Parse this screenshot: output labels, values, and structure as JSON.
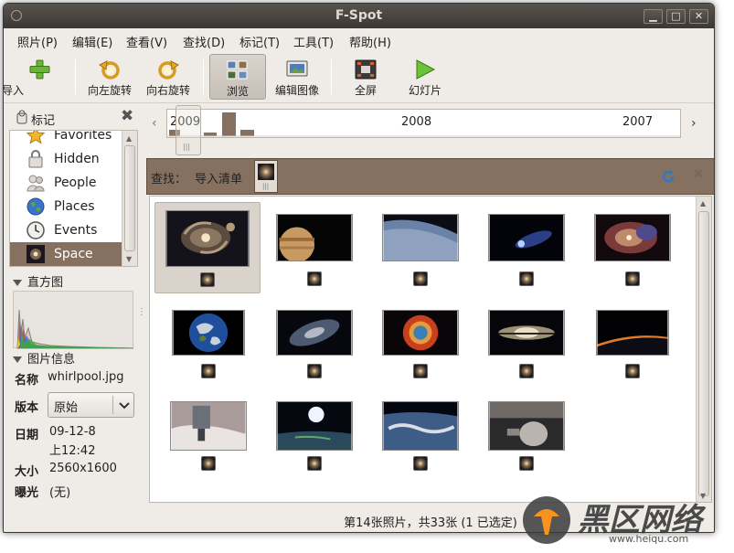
{
  "window": {
    "title": "F-Spot",
    "min_label": "▁",
    "max_label": "□",
    "close_label": "✕"
  },
  "menu": [
    "照片(P)",
    "编辑(E)",
    "查看(V)",
    "查找(D)",
    "标记(T)",
    "工具(T)",
    "帮助(H)"
  ],
  "toolbar": {
    "import": "导入",
    "rotate_left": "向左旋转",
    "rotate_right": "向右旋转",
    "browse": "浏览",
    "edit_image": "编辑图像",
    "fullscreen": "全屏",
    "slideshow": "幻灯片"
  },
  "sidebar": {
    "tags_label": "标记",
    "tags": [
      {
        "label": "Favorites",
        "icon": "star-icon"
      },
      {
        "label": "Hidden",
        "icon": "lock-icon"
      },
      {
        "label": "People",
        "icon": "people-icon"
      },
      {
        "label": "Places",
        "icon": "globe-icon"
      },
      {
        "label": "Events",
        "icon": "clock-icon"
      },
      {
        "label": "Space",
        "icon": "galaxy-icon",
        "selected": true
      }
    ],
    "histogram_label": "直方图",
    "info_label": "图片信息",
    "info": {
      "name_key": "名称",
      "name_val": "whirlpool.jpg",
      "version_key": "版本",
      "version_val": "原始",
      "date_key": "日期",
      "date_val": "09-12-8",
      "time_val": "上12:42",
      "size_key": "大小",
      "size_val": "2560x1600",
      "exposure_key": "曝光",
      "exposure_val": "(无)"
    }
  },
  "timeline": {
    "years": [
      "2009",
      "2008",
      "2007"
    ]
  },
  "findbar": {
    "label": "查找：",
    "query": "导入清单"
  },
  "photos": [
    {
      "name": "whirlpool galaxy",
      "selected": true
    },
    {
      "name": "jupiter"
    },
    {
      "name": "earth horizon"
    },
    {
      "name": "comet"
    },
    {
      "name": "orion nebula"
    },
    {
      "name": "blue marble"
    },
    {
      "name": "spiral galaxy"
    },
    {
      "name": "helix nebula"
    },
    {
      "name": "sombrero galaxy"
    },
    {
      "name": "sunrise over earth"
    },
    {
      "name": "space station over clouds"
    },
    {
      "name": "sun over earth"
    },
    {
      "name": "earth from orbit"
    },
    {
      "name": "soyuz spacecraft"
    }
  ],
  "status": "第14张照片，共33张 (1 已选定)",
  "watermark": {
    "text": "黑区网络",
    "url": "www.heiqu.com"
  },
  "colors": {
    "accent": "#86705f",
    "titlebar": "#3c3833",
    "window_bg": "#efebe7"
  }
}
